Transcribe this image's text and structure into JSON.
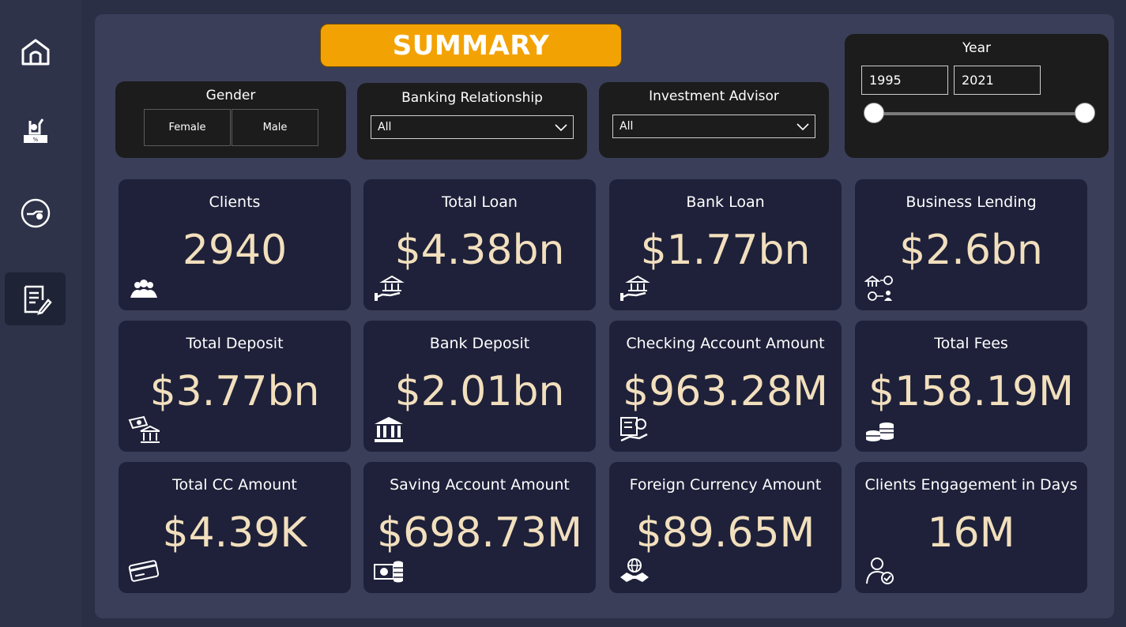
{
  "title": "SUMMARY",
  "nav": [
    {
      "icon": "home-icon"
    },
    {
      "icon": "loan-icon"
    },
    {
      "icon": "deposit-icon"
    },
    {
      "icon": "summary-report-icon",
      "active": true
    }
  ],
  "filters": {
    "gender": {
      "title": "Gender",
      "options": [
        "Female",
        "Male"
      ]
    },
    "banking_relationship": {
      "title": "Banking Relationship",
      "selected": "All"
    },
    "investment_advisor": {
      "title": "Investment Advisor",
      "selected": "All"
    },
    "year": {
      "title": "Year",
      "from": "1995",
      "to": "2021"
    }
  },
  "cards": [
    {
      "label": "Clients",
      "value": "2940",
      "icon": "clients-icon"
    },
    {
      "label": "Total Loan",
      "value": "$4.38bn",
      "icon": "bank-hand-icon"
    },
    {
      "label": "Bank Loan",
      "value": "$1.77bn",
      "icon": "bank-hand-icon"
    },
    {
      "label": "Business Lending",
      "value": "$2.6bn",
      "icon": "business-lending-icon"
    },
    {
      "label": "Total Deposit",
      "value": "$3.77bn",
      "icon": "deposit-money-icon"
    },
    {
      "label": "Bank Deposit",
      "value": "$2.01bn",
      "icon": "bank-building-icon"
    },
    {
      "label": "Checking Account Amount",
      "value": "$963.28M",
      "icon": "checking-account-icon"
    },
    {
      "label": "Total Fees",
      "value": "$158.19M",
      "icon": "coins-stack-icon"
    },
    {
      "label": "Total CC Amount",
      "value": "$4.39K",
      "icon": "credit-card-icon"
    },
    {
      "label": "Saving Account Amount",
      "value": "$698.73M",
      "icon": "cash-coins-icon"
    },
    {
      "label": "Foreign Currency Amount",
      "value": "$89.65M",
      "icon": "globe-handshake-icon"
    },
    {
      "label": "Clients Engagement in Days",
      "value": "16M",
      "icon": "user-check-icon"
    }
  ],
  "colors": {
    "background": "#2b2f45",
    "panel": "#3a3e59",
    "card": "#1e2139",
    "accent": "#f3a203",
    "value_text": "#f2dfbd"
  }
}
